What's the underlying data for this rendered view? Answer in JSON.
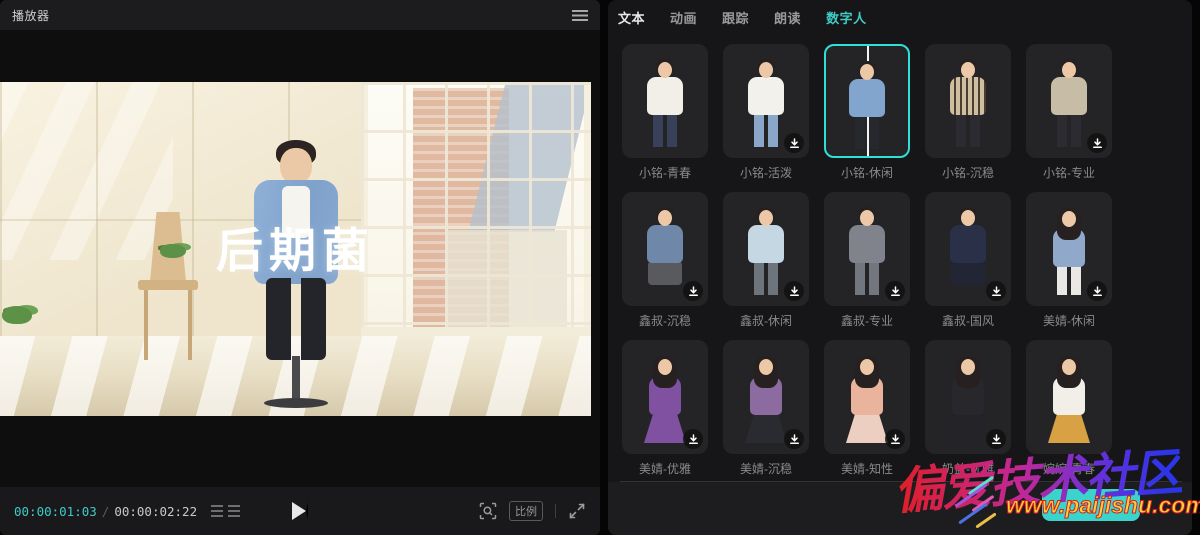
{
  "player": {
    "title": "播放器",
    "video_overlay_text": "后期菌",
    "transport": {
      "current_time": "00:00:01:03",
      "separator": "/",
      "duration": "00:00:02:22"
    },
    "ratio_label": "比例"
  },
  "inspector": {
    "tabs": [
      {
        "label": "文本",
        "state": "bright"
      },
      {
        "label": "动画",
        "state": "normal"
      },
      {
        "label": "跟踪",
        "state": "normal"
      },
      {
        "label": "朗读",
        "state": "normal"
      },
      {
        "label": "数字人",
        "state": "active"
      }
    ],
    "avatars": [
      {
        "label": "小铭-青春",
        "selected": false,
        "download": false,
        "style": "stand",
        "hair": "short",
        "stripe": false,
        "top": "#f1efe8",
        "bottom": "#39415a"
      },
      {
        "label": "小铭-活泼",
        "selected": false,
        "download": true,
        "style": "stand",
        "hair": "short",
        "stripe": false,
        "top": "#f3f1ec",
        "bottom": "#8aa6c8"
      },
      {
        "label": "小铭-休闲",
        "selected": true,
        "download": false,
        "style": "stand",
        "hair": "short",
        "stripe": false,
        "top": "#82a5cd",
        "bottom": "#26282e"
      },
      {
        "label": "小铭-沉稳",
        "selected": false,
        "download": false,
        "style": "stand",
        "hair": "short",
        "stripe": true,
        "top": "#cdbf9f",
        "bottom": "#2b2b31"
      },
      {
        "label": "小铭-专业",
        "selected": false,
        "download": true,
        "style": "stand",
        "hair": "short",
        "stripe": false,
        "top": "#c7bda6",
        "bottom": "#2b2b31"
      },
      {
        "label": "鑫叔-沉稳",
        "selected": false,
        "download": true,
        "style": "sit",
        "hair": "short",
        "stripe": false,
        "top": "#6f88a9",
        "bottom": "#595a5e"
      },
      {
        "label": "鑫叔-休闲",
        "selected": false,
        "download": true,
        "style": "stand",
        "hair": "short",
        "stripe": false,
        "top": "#c6d7e4",
        "bottom": "#6e747b"
      },
      {
        "label": "鑫叔-专业",
        "selected": false,
        "download": true,
        "style": "stand",
        "hair": "short",
        "stripe": false,
        "top": "#80838c",
        "bottom": "#72767e"
      },
      {
        "label": "鑫叔-国风",
        "selected": false,
        "download": true,
        "style": "sit",
        "hair": "short",
        "stripe": false,
        "top": "#2a3048",
        "bottom": "#222634"
      },
      {
        "label": "美婧-休闲",
        "selected": false,
        "download": true,
        "style": "stand",
        "hair": "long",
        "stripe": false,
        "top": "#90a8ca",
        "bottom": "#eae8e4"
      },
      {
        "label": "美婧-优雅",
        "selected": false,
        "download": true,
        "style": "dress",
        "hair": "long",
        "stripe": false,
        "top": "#7f51a0",
        "bottom": "#7f51a0"
      },
      {
        "label": "美婧-沉稳",
        "selected": false,
        "download": true,
        "style": "dress",
        "hair": "long",
        "stripe": false,
        "top": "#8c6ba1",
        "bottom": "#2a2a31"
      },
      {
        "label": "美婧-知性",
        "selected": false,
        "download": true,
        "style": "dress",
        "hair": "long",
        "stripe": false,
        "top": "#e9b49b",
        "bottom": "#eccfc0"
      },
      {
        "label": "奶盖-优雅",
        "selected": false,
        "download": true,
        "style": "dress",
        "hair": "long",
        "stripe": false,
        "top": "#27272c",
        "bottom": "#232328"
      },
      {
        "label": "婉婉-青春",
        "selected": false,
        "download": false,
        "style": "dress",
        "hair": "long",
        "stripe": false,
        "top": "#f2efe9",
        "bottom": "#d8a244"
      }
    ]
  },
  "watermark": {
    "title": "偏爱技术社区",
    "url": "www.paijishu.com"
  },
  "colors": {
    "accent": "#3fcbc5",
    "selection_border": "#2ee0d8",
    "time_current": "#3fcbc5"
  },
  "icons": {
    "menu": "hamburger",
    "play": "triangle",
    "frames": "stacked-rows",
    "preview_focus": "magnifier-brackets",
    "fullscreen": "expand-arrows",
    "download": "arrow-down-to-line"
  }
}
